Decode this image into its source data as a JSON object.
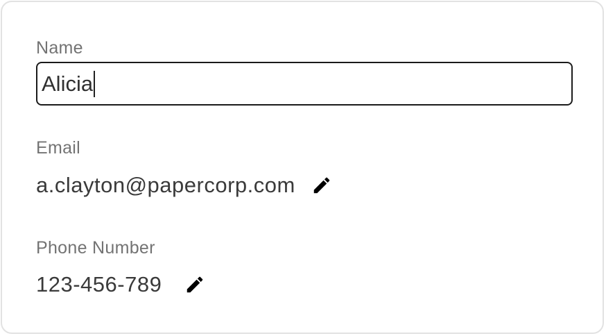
{
  "form": {
    "name": {
      "label": "Name",
      "value": "Alicia"
    },
    "email": {
      "label": "Email",
      "value": "a.clayton@papercorp.com",
      "edit_icon": "pencil-icon"
    },
    "phone": {
      "label": "Phone Number",
      "value": "123-456-789",
      "edit_icon": "pencil-icon"
    }
  },
  "colors": {
    "label": "#737373",
    "value": "#3a3a3a",
    "input_border": "#1a1a1a",
    "card_border": "#e2e2e2"
  }
}
